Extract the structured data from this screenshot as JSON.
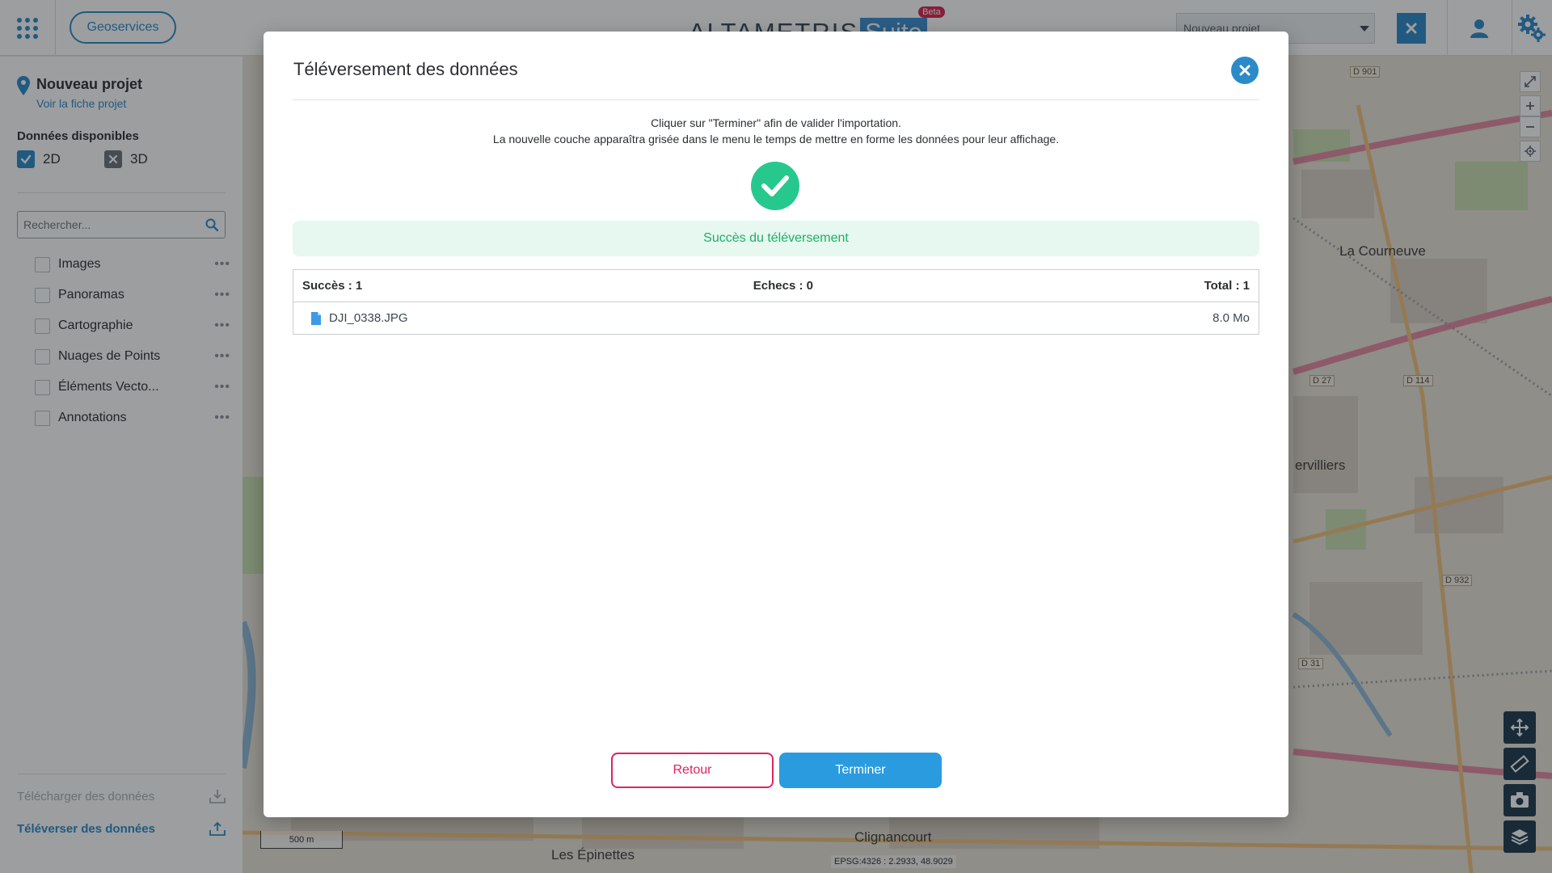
{
  "header": {
    "geoservices_label": "Geoservices",
    "brand_name": "ALTAMETRIS",
    "brand_suite": "Suite",
    "brand_badge": "Beta",
    "project_select_value": "Nouveau projet"
  },
  "sidebar": {
    "project_title": "Nouveau projet",
    "project_link": "Voir la fiche projet",
    "available_title": "Données disponibles",
    "dim_2d": "2D",
    "dim_3d": "3D",
    "search_placeholder": "Rechercher...",
    "layers": [
      {
        "label": "Images"
      },
      {
        "label": "Panoramas"
      },
      {
        "label": "Cartographie"
      },
      {
        "label": "Nuages de Points"
      },
      {
        "label": "Éléments Vecto..."
      },
      {
        "label": "Annotations"
      }
    ],
    "download_label": "Télécharger des données",
    "upload_label": "Téléverser des données"
  },
  "map": {
    "scale": "500 m",
    "coords": "EPSG:4326 : 2.2933, 48.9029",
    "labels": {
      "la_courneuve": "La Courneuve",
      "aubervilliers": "ervilliers",
      "clignancourt": "Clignancourt",
      "les_epinettes": "Les Épinettes",
      "d901": "D 901",
      "d27": "D 27",
      "d114": "D 114",
      "d932": "D 932",
      "d31": "D 31"
    }
  },
  "modal": {
    "title": "Téléversement des données",
    "instruction_line1": "Cliquer sur \"Terminer\" afin de valider l'importation.",
    "instruction_line2": "La nouvelle couche apparaîtra grisée dans le menu le temps de mettre en forme les données pour leur affichage.",
    "success_message": "Succès du téléversement",
    "summary": {
      "success": "Succès : 1",
      "failures": "Echecs : 0",
      "total": "Total : 1"
    },
    "files": [
      {
        "name": "DJI_0338.JPG",
        "size": "8.0 Mo"
      }
    ],
    "back_label": "Retour",
    "finish_label": "Terminer"
  },
  "colors": {
    "accent": "#2b8bc9",
    "success": "#27c88e",
    "danger": "#e0245e"
  }
}
